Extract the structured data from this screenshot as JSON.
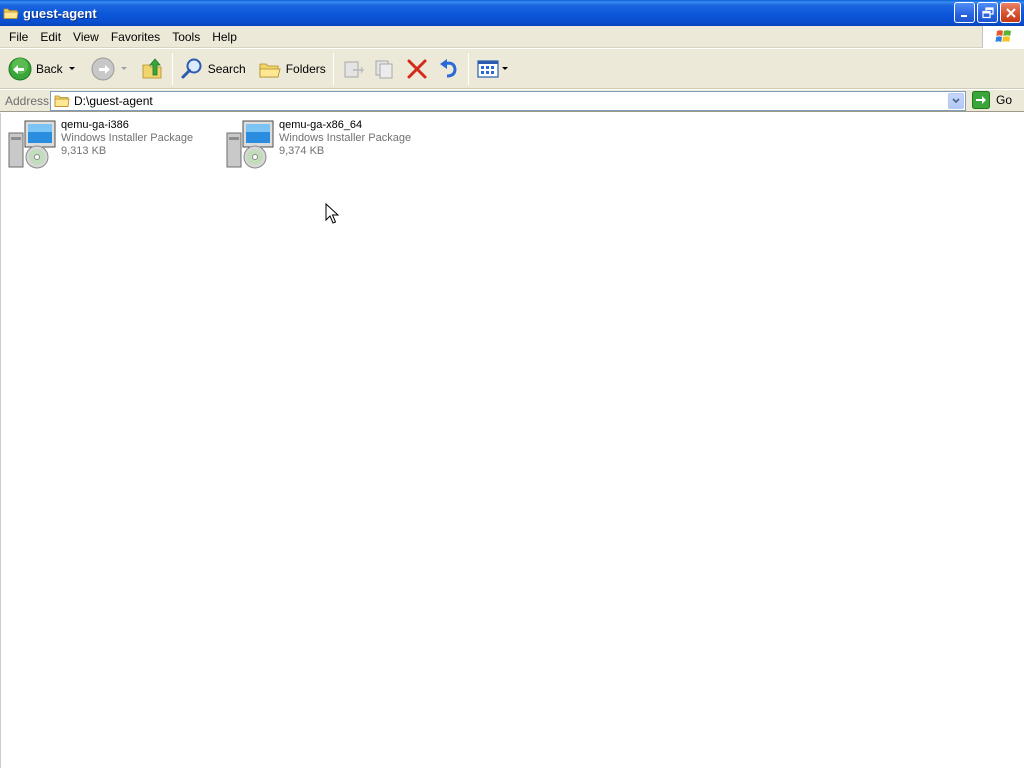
{
  "window": {
    "title": "guest-agent"
  },
  "menu": {
    "items": [
      "File",
      "Edit",
      "View",
      "Favorites",
      "Tools",
      "Help"
    ]
  },
  "toolbar": {
    "back_label": "Back",
    "search_label": "Search",
    "folders_label": "Folders"
  },
  "address": {
    "label": "Address",
    "value": "D:\\guest-agent",
    "go_label": "Go"
  },
  "files": [
    {
      "name": "qemu-ga-i386",
      "type": "Windows Installer Package",
      "size": "9,313 KB"
    },
    {
      "name": "qemu-ga-x86_64",
      "type": "Windows Installer Package",
      "size": "9,374 KB"
    }
  ],
  "colors": {
    "titlebar": "#0a55d8",
    "chrome": "#ece9d8",
    "close": "#d9532f",
    "secondary_text": "#717171"
  }
}
